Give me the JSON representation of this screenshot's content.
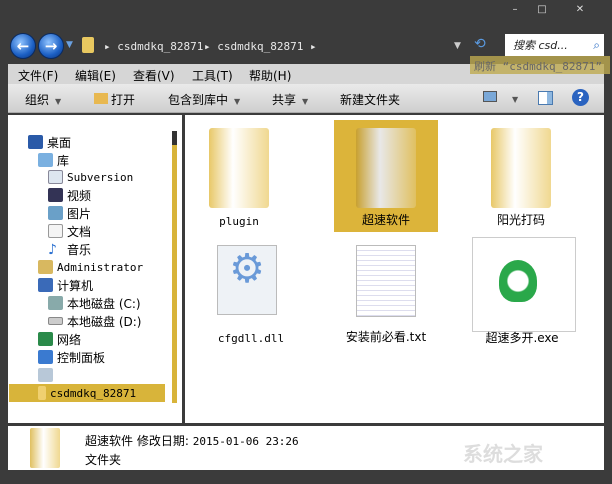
{
  "window": {
    "minimize": "–",
    "maximize": "□",
    "close": "✕"
  },
  "address": {
    "crumbs": [
      "csdmdkq_82871",
      "csdmdkq_82871"
    ],
    "search_placeholder": "搜索 csd...",
    "refresh_tooltip": "刷新 “csdmdkq_82871”"
  },
  "menu": [
    "文件(F)",
    "编辑(E)",
    "查看(V)",
    "工具(T)",
    "帮助(H)"
  ],
  "toolbar": {
    "organize": "组织",
    "open": "打开",
    "include": "包含到库中",
    "share": "共享",
    "new_folder": "新建文件夹"
  },
  "nav": {
    "desktop": "桌面",
    "libraries": "库",
    "subversion": "Subversion",
    "videos": "视频",
    "pictures": "图片",
    "documents": "文档",
    "music": "音乐",
    "admin": "Administrator",
    "computer": "计算机",
    "drive_c": "本地磁盘 (C:)",
    "drive_d": "本地磁盘 (D:)",
    "network": "网络",
    "control_panel": "控制面板",
    "current": "csdmdkq_82871"
  },
  "files": [
    {
      "name": "plugin"
    },
    {
      "name": "超速软件"
    },
    {
      "name": "阳光打码"
    },
    {
      "name": "cfgdll.dll"
    },
    {
      "name": "安装前必看.txt"
    },
    {
      "name": "超速多开.exe"
    }
  ],
  "details": {
    "name": "超速软件",
    "modified_label": "修改日期:",
    "modified": "2015-01-06 23:26",
    "type": "文件夹"
  },
  "watermark": "系统之家"
}
